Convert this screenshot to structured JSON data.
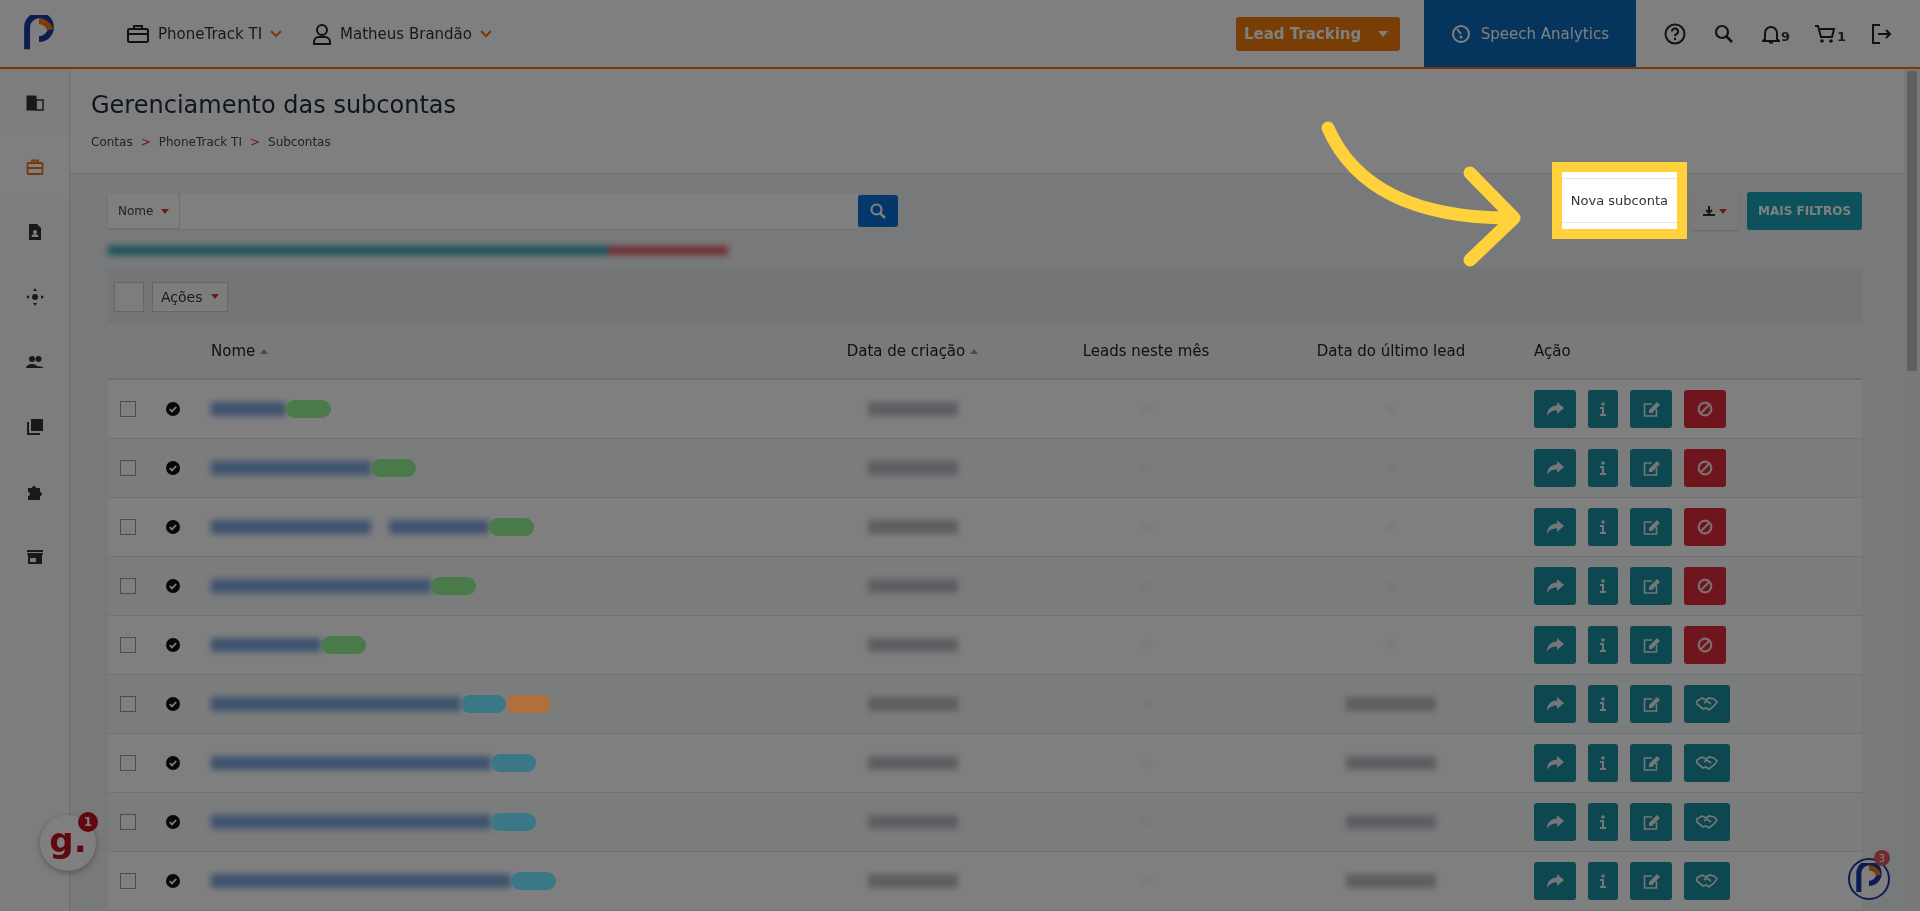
{
  "header": {
    "account": "PhoneTrack TI",
    "user": "Matheus Brandão",
    "product_menu": "Lead Tracking",
    "speech_analytics": "Speech Analytics",
    "notifications": "9",
    "cart": "1"
  },
  "sidebar": [
    {
      "kind": "building",
      "selected": false
    },
    {
      "kind": "briefcase",
      "selected": true
    },
    {
      "kind": "contact",
      "selected": false
    },
    {
      "kind": "move",
      "selected": false
    },
    {
      "kind": "people",
      "selected": false
    },
    {
      "kind": "library",
      "selected": false
    },
    {
      "kind": "puzzle",
      "selected": false
    },
    {
      "kind": "store",
      "selected": false
    }
  ],
  "page": {
    "title": "Gerenciamento das subcontas",
    "breadcrumb": [
      {
        "label": "Contas",
        "separator": ">"
      },
      {
        "label": "PhoneTrack TI",
        "separator": ">"
      },
      {
        "label": "Subcontas"
      }
    ]
  },
  "search": {
    "field": "Nome"
  },
  "toolbar": {
    "new_button": {
      "label": "Nova subconta",
      "highlighted": true
    },
    "filters_button": "MAIS FILTROS"
  },
  "table": {
    "actions_menu": "Ações",
    "select_all": false,
    "columns": [
      {
        "label": "Nome",
        "sortable": true
      },
      {
        "label": "Data de criação",
        "sortable": true
      },
      {
        "label": "Leads neste mês",
        "sortable": false
      },
      {
        "label": "Data do último lead",
        "sortable": false
      },
      {
        "label": "Ação",
        "sortable": false
      }
    ],
    "rows": [
      {
        "checked": false,
        "active": true,
        "kind": "block",
        "tags": [
          {
            "color": "#4a7a4a"
          }
        ]
      },
      {
        "checked": false,
        "active": true,
        "kind": "block",
        "tags": [
          {
            "color": "#4a7a4a"
          }
        ]
      },
      {
        "checked": false,
        "active": true,
        "kind": "block",
        "tags": [
          {
            "color": "#4a7a4a"
          }
        ]
      },
      {
        "checked": false,
        "active": true,
        "kind": "block",
        "tags": [
          {
            "color": "#4a7a4a"
          }
        ]
      },
      {
        "checked": false,
        "active": true,
        "kind": "block",
        "tags": [
          {
            "color": "#4a7a4a"
          }
        ]
      },
      {
        "checked": false,
        "active": true,
        "kind": "handshake",
        "tags": [
          {
            "color": "#3a7888"
          },
          {
            "color": "#b0703a"
          }
        ]
      },
      {
        "checked": false,
        "active": true,
        "kind": "handshake",
        "tags": [
          {
            "color": "#3a7888"
          }
        ]
      },
      {
        "checked": false,
        "active": true,
        "kind": "handshake",
        "tags": [
          {
            "color": "#3a7888"
          }
        ]
      },
      {
        "checked": false,
        "active": true,
        "kind": "handshake",
        "tags": [
          {
            "color": "#3a7888"
          }
        ]
      }
    ]
  },
  "widgets": {
    "left_logo": "g.",
    "left_badge": "1",
    "right_badge": "3"
  }
}
